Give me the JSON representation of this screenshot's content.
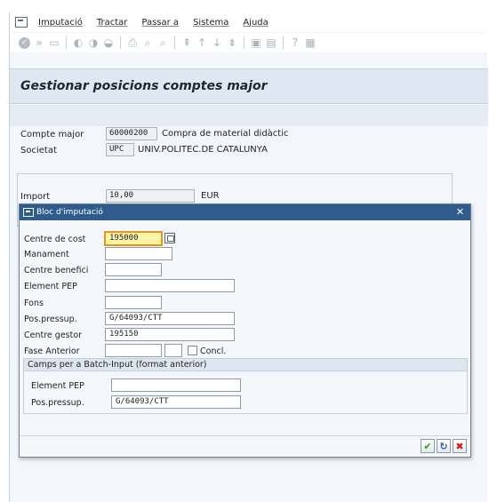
{
  "menubar": {
    "items": [
      "Imputació",
      "Tractar",
      "Passar a",
      "Sistema",
      "Ajuda"
    ]
  },
  "header": {
    "title": "Gestionar posicions comptes major"
  },
  "main": {
    "compte_major": {
      "label": "Compte major",
      "value": "60000200",
      "text": "Compra de material didàctic"
    },
    "societat": {
      "label": "Societat",
      "value": "UPC",
      "text": "UNIV.POLITEC.DE CATALUNYA"
    },
    "import": {
      "label": "Import",
      "value": "10,00",
      "currency": "EUR"
    }
  },
  "dialog": {
    "title": "Bloc d'imputació",
    "fields": {
      "centre_de_cost": {
        "label": "Centre de cost",
        "value": "195000"
      },
      "manament": {
        "label": "Manament",
        "value": ""
      },
      "centre_benefici": {
        "label": "Centre benefici",
        "value": ""
      },
      "element_pep": {
        "label": "Element PEP",
        "value": ""
      },
      "fons": {
        "label": "Fons",
        "value": ""
      },
      "pos_pressup": {
        "label": "Pos.pressup.",
        "value": "G/64093/CTT"
      },
      "centre_gestor": {
        "label": "Centre gestor",
        "value": "195150"
      },
      "fase_anterior": {
        "label": "Fase Anterior",
        "value": "",
        "value2": "",
        "concl_label": "Concl."
      }
    },
    "batch": {
      "heading": "Camps per a Batch-Input (format anterior)",
      "element_pep": {
        "label": "Element PEP",
        "value": ""
      },
      "pos_pressup": {
        "label": "Pos.pressup.",
        "value": "G/64093/CTT"
      }
    }
  },
  "icons": {
    "accent": "#2f5c8c",
    "highlight": "#fff3a8",
    "ok_color": "#2c9a1a",
    "cancel_color": "#c8211a"
  }
}
